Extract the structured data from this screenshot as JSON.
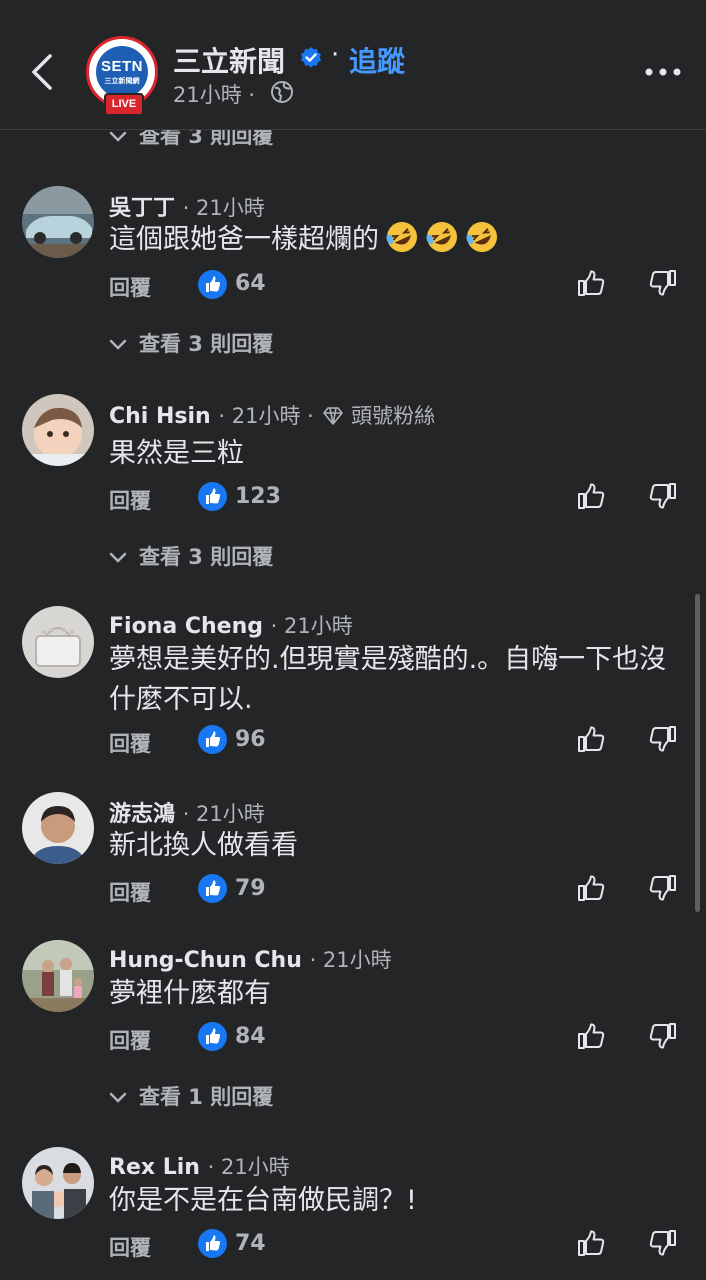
{
  "header": {
    "page_name": "三立新聞",
    "dot": "·",
    "follow": "追蹤",
    "time": "21小時 ·",
    "logo_text": "SETN",
    "logo_sub": "三立新聞網",
    "live": "LIVE"
  },
  "top_replies": "查看 3 則回覆",
  "comments": [
    {
      "name": "吳丁丁",
      "time": "· 21小時",
      "text": "這個跟她爸一樣超爛的",
      "emoji": "rolling-on-floor-laughing x3",
      "reply": "回覆",
      "likes": "64",
      "replies": "查看 3 則回覆"
    },
    {
      "name": "Chi Hsin",
      "time": "· 21小時 ·",
      "badge": "頭號粉絲",
      "text": "果然是三粒",
      "reply": "回覆",
      "likes": "123",
      "replies": "查看 3 則回覆"
    },
    {
      "name": "Fiona Cheng",
      "time": "· 21小時",
      "text": "夢想是美好的.但現實是殘酷的.。自嗨一下也沒什麼不可以.",
      "reply": "回覆",
      "likes": "96"
    },
    {
      "name": "游志鴻",
      "time": "· 21小時",
      "text": "新北換人做看看",
      "reply": "回覆",
      "likes": "79"
    },
    {
      "name": "Hung-Chun Chu",
      "time": "· 21小時",
      "text": "夢裡什麼都有",
      "reply": "回覆",
      "likes": "84",
      "replies": "查看 1 則回覆"
    },
    {
      "name": "Rex Lin",
      "time": "· 21小時",
      "text": "你是不是在台南做民調？!",
      "reply": "回覆",
      "likes": "74"
    }
  ],
  "colors": {
    "background": "#242526",
    "accent": "#4599ff",
    "like": "#1877f2",
    "secondary_text": "#b0b3b8"
  }
}
